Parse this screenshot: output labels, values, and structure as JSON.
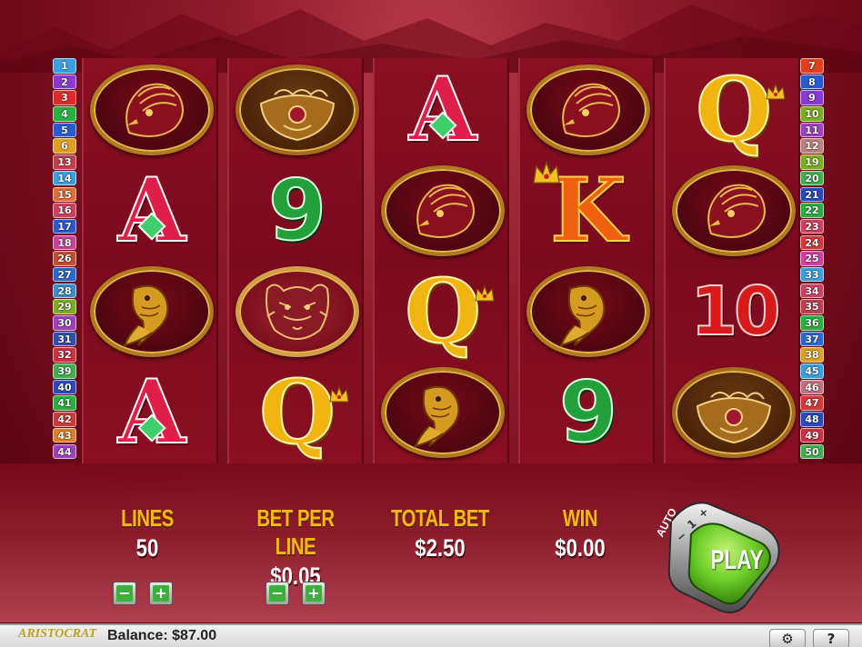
{
  "lines_left": [
    {
      "n": "1",
      "c": "#3aa0e0"
    },
    {
      "n": "2",
      "c": "#8a3ad0"
    },
    {
      "n": "3",
      "c": "#e02a2a"
    },
    {
      "n": "4",
      "c": "#2ab040"
    },
    {
      "n": "5",
      "c": "#2a5ad0"
    },
    {
      "n": "6",
      "c": "#e0a020"
    },
    {
      "n": "13",
      "c": "#c04050"
    },
    {
      "n": "14",
      "c": "#3aa0e0"
    },
    {
      "n": "15",
      "c": "#e07030"
    },
    {
      "n": "16",
      "c": "#d04060"
    },
    {
      "n": "17",
      "c": "#2a5ad0"
    },
    {
      "n": "18",
      "c": "#d040a0"
    },
    {
      "n": "26",
      "c": "#c05030"
    },
    {
      "n": "27",
      "c": "#2a6ad0"
    },
    {
      "n": "28",
      "c": "#3a90d0"
    },
    {
      "n": "29",
      "c": "#7ab020"
    },
    {
      "n": "30",
      "c": "#a040c0"
    },
    {
      "n": "31",
      "c": "#3050b0"
    },
    {
      "n": "32",
      "c": "#d03040"
    },
    {
      "n": "39",
      "c": "#40b050"
    },
    {
      "n": "40",
      "c": "#2a4ac0"
    },
    {
      "n": "41",
      "c": "#2ab040"
    },
    {
      "n": "42",
      "c": "#d03a3a"
    },
    {
      "n": "43",
      "c": "#e08020"
    },
    {
      "n": "44",
      "c": "#a040c0"
    }
  ],
  "lines_right": [
    {
      "n": "7",
      "c": "#e04020"
    },
    {
      "n": "8",
      "c": "#2a5ad0"
    },
    {
      "n": "9",
      "c": "#8a3ad0"
    },
    {
      "n": "10",
      "c": "#7ab020"
    },
    {
      "n": "11",
      "c": "#a040c0"
    },
    {
      "n": "12",
      "c": "#c08080"
    },
    {
      "n": "19",
      "c": "#7ab020"
    },
    {
      "n": "20",
      "c": "#40b050"
    },
    {
      "n": "21",
      "c": "#2a4ac0"
    },
    {
      "n": "22",
      "c": "#2ab040"
    },
    {
      "n": "23",
      "c": "#d04060"
    },
    {
      "n": "24",
      "c": "#d03a3a"
    },
    {
      "n": "25",
      "c": "#d040a0"
    },
    {
      "n": "33",
      "c": "#3aa0e0"
    },
    {
      "n": "34",
      "c": "#d04060"
    },
    {
      "n": "35",
      "c": "#c04050"
    },
    {
      "n": "36",
      "c": "#2ab040"
    },
    {
      "n": "37",
      "c": "#2a6ad0"
    },
    {
      "n": "38",
      "c": "#e0a020"
    },
    {
      "n": "45",
      "c": "#3aa0e0"
    },
    {
      "n": "46",
      "c": "#c07080"
    },
    {
      "n": "47",
      "c": "#d03a3a"
    },
    {
      "n": "48",
      "c": "#2a4ac0"
    },
    {
      "n": "49",
      "c": "#d03040"
    },
    {
      "n": "50",
      "c": "#40b050"
    }
  ],
  "reels": [
    [
      "phoenix",
      "A",
      "koi",
      "A"
    ],
    [
      "bowl",
      "9",
      "tiger",
      "Q"
    ],
    [
      "A",
      "phoenix",
      "Q",
      "koi"
    ],
    [
      "phoenix",
      "K",
      "koi",
      "9"
    ],
    [
      "Q",
      "phoenix",
      "10",
      "bowl"
    ]
  ],
  "stats": {
    "lines_label": "LINES",
    "lines_value": "50",
    "bet_label": "BET PER LINE",
    "bet_value": "$0.05",
    "total_label": "TOTAL BET",
    "total_value": "$2.50",
    "win_label": "WIN",
    "win_value": "$0.00"
  },
  "buttons": {
    "minus": "−",
    "plus": "+"
  },
  "play": {
    "label": "PLAY",
    "auto_label": "AUTO",
    "auto_minus": "−",
    "auto_count": "1",
    "auto_plus": "+"
  },
  "footer": {
    "logo": "ARISTOCRAT",
    "balance_label": "Balance:",
    "balance_value": "$87.00",
    "settings": "⚙",
    "help": "?"
  },
  "colors": {
    "accent_gold": "#f7b80e",
    "play_green": "#6fcf2a"
  }
}
